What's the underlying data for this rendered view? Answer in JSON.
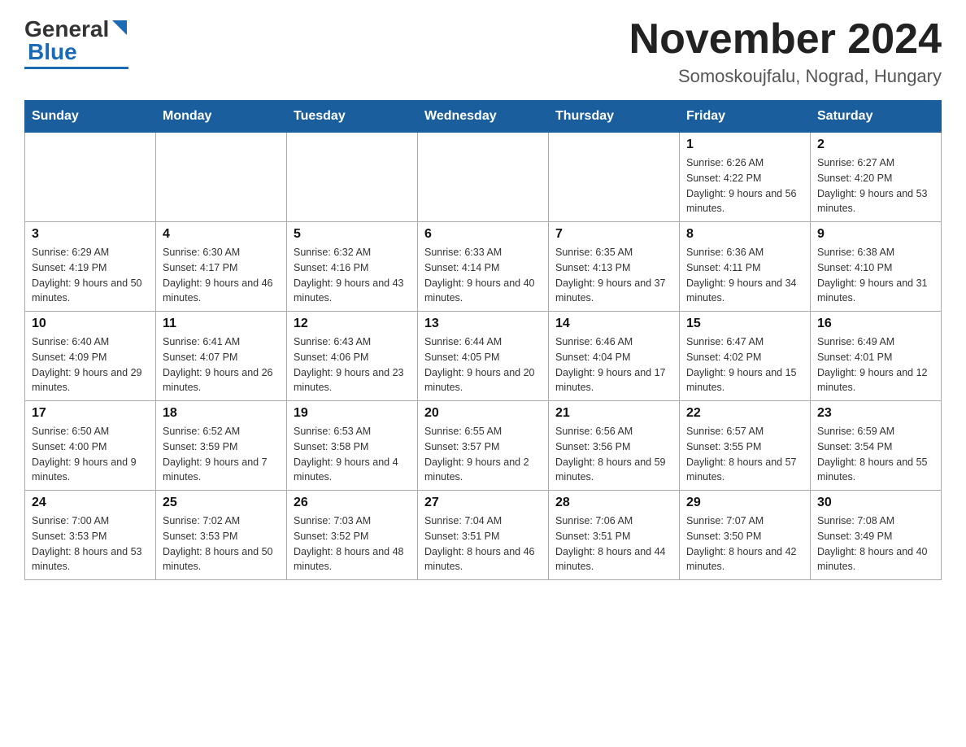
{
  "header": {
    "logo_main": "General",
    "logo_blue": "Blue",
    "month_title": "November 2024",
    "location": "Somoskoujfalu, Nograd, Hungary"
  },
  "days_of_week": [
    "Sunday",
    "Monday",
    "Tuesday",
    "Wednesday",
    "Thursday",
    "Friday",
    "Saturday"
  ],
  "weeks": [
    [
      {
        "day": "",
        "info": ""
      },
      {
        "day": "",
        "info": ""
      },
      {
        "day": "",
        "info": ""
      },
      {
        "day": "",
        "info": ""
      },
      {
        "day": "",
        "info": ""
      },
      {
        "day": "1",
        "info": "Sunrise: 6:26 AM\nSunset: 4:22 PM\nDaylight: 9 hours and 56 minutes."
      },
      {
        "day": "2",
        "info": "Sunrise: 6:27 AM\nSunset: 4:20 PM\nDaylight: 9 hours and 53 minutes."
      }
    ],
    [
      {
        "day": "3",
        "info": "Sunrise: 6:29 AM\nSunset: 4:19 PM\nDaylight: 9 hours and 50 minutes."
      },
      {
        "day": "4",
        "info": "Sunrise: 6:30 AM\nSunset: 4:17 PM\nDaylight: 9 hours and 46 minutes."
      },
      {
        "day": "5",
        "info": "Sunrise: 6:32 AM\nSunset: 4:16 PM\nDaylight: 9 hours and 43 minutes."
      },
      {
        "day": "6",
        "info": "Sunrise: 6:33 AM\nSunset: 4:14 PM\nDaylight: 9 hours and 40 minutes."
      },
      {
        "day": "7",
        "info": "Sunrise: 6:35 AM\nSunset: 4:13 PM\nDaylight: 9 hours and 37 minutes."
      },
      {
        "day": "8",
        "info": "Sunrise: 6:36 AM\nSunset: 4:11 PM\nDaylight: 9 hours and 34 minutes."
      },
      {
        "day": "9",
        "info": "Sunrise: 6:38 AM\nSunset: 4:10 PM\nDaylight: 9 hours and 31 minutes."
      }
    ],
    [
      {
        "day": "10",
        "info": "Sunrise: 6:40 AM\nSunset: 4:09 PM\nDaylight: 9 hours and 29 minutes."
      },
      {
        "day": "11",
        "info": "Sunrise: 6:41 AM\nSunset: 4:07 PM\nDaylight: 9 hours and 26 minutes."
      },
      {
        "day": "12",
        "info": "Sunrise: 6:43 AM\nSunset: 4:06 PM\nDaylight: 9 hours and 23 minutes."
      },
      {
        "day": "13",
        "info": "Sunrise: 6:44 AM\nSunset: 4:05 PM\nDaylight: 9 hours and 20 minutes."
      },
      {
        "day": "14",
        "info": "Sunrise: 6:46 AM\nSunset: 4:04 PM\nDaylight: 9 hours and 17 minutes."
      },
      {
        "day": "15",
        "info": "Sunrise: 6:47 AM\nSunset: 4:02 PM\nDaylight: 9 hours and 15 minutes."
      },
      {
        "day": "16",
        "info": "Sunrise: 6:49 AM\nSunset: 4:01 PM\nDaylight: 9 hours and 12 minutes."
      }
    ],
    [
      {
        "day": "17",
        "info": "Sunrise: 6:50 AM\nSunset: 4:00 PM\nDaylight: 9 hours and 9 minutes."
      },
      {
        "day": "18",
        "info": "Sunrise: 6:52 AM\nSunset: 3:59 PM\nDaylight: 9 hours and 7 minutes."
      },
      {
        "day": "19",
        "info": "Sunrise: 6:53 AM\nSunset: 3:58 PM\nDaylight: 9 hours and 4 minutes."
      },
      {
        "day": "20",
        "info": "Sunrise: 6:55 AM\nSunset: 3:57 PM\nDaylight: 9 hours and 2 minutes."
      },
      {
        "day": "21",
        "info": "Sunrise: 6:56 AM\nSunset: 3:56 PM\nDaylight: 8 hours and 59 minutes."
      },
      {
        "day": "22",
        "info": "Sunrise: 6:57 AM\nSunset: 3:55 PM\nDaylight: 8 hours and 57 minutes."
      },
      {
        "day": "23",
        "info": "Sunrise: 6:59 AM\nSunset: 3:54 PM\nDaylight: 8 hours and 55 minutes."
      }
    ],
    [
      {
        "day": "24",
        "info": "Sunrise: 7:00 AM\nSunset: 3:53 PM\nDaylight: 8 hours and 53 minutes."
      },
      {
        "day": "25",
        "info": "Sunrise: 7:02 AM\nSunset: 3:53 PM\nDaylight: 8 hours and 50 minutes."
      },
      {
        "day": "26",
        "info": "Sunrise: 7:03 AM\nSunset: 3:52 PM\nDaylight: 8 hours and 48 minutes."
      },
      {
        "day": "27",
        "info": "Sunrise: 7:04 AM\nSunset: 3:51 PM\nDaylight: 8 hours and 46 minutes."
      },
      {
        "day": "28",
        "info": "Sunrise: 7:06 AM\nSunset: 3:51 PM\nDaylight: 8 hours and 44 minutes."
      },
      {
        "day": "29",
        "info": "Sunrise: 7:07 AM\nSunset: 3:50 PM\nDaylight: 8 hours and 42 minutes."
      },
      {
        "day": "30",
        "info": "Sunrise: 7:08 AM\nSunset: 3:49 PM\nDaylight: 8 hours and 40 minutes."
      }
    ]
  ]
}
